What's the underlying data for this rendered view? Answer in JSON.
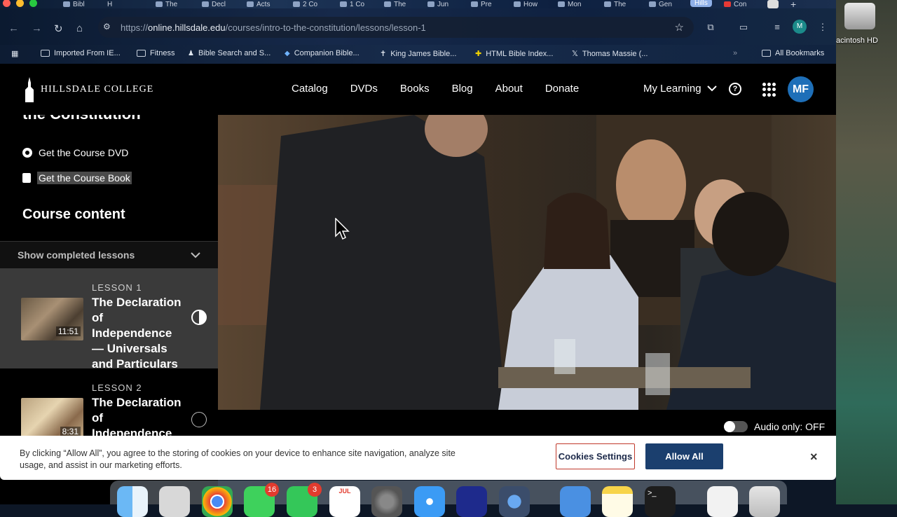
{
  "desktop": {
    "drive_label": "acintosh HD"
  },
  "browser": {
    "tabs": [
      "Bibl",
      "H",
      "The",
      "Decl",
      "Acts",
      "2 Co",
      "1 Co",
      "The",
      "Jun",
      "Pre",
      "How",
      "Mon",
      "The",
      "Gen",
      "Hills",
      "Con"
    ],
    "active_tab": "Hills",
    "url_host": "online.hillsdale.edu",
    "url_path": "/courses/intro-to-the-constitution/lessons/lesson-1",
    "url_scheme": "https://",
    "profile_initial": "M",
    "bookmarks": [
      "Imported From IE...",
      "Fitness",
      "Bible Search and S...",
      "Companion Bible...",
      "King James Bible...",
      "HTML Bible Index...",
      "Thomas Massie (...",
      "All Bookmarks"
    ]
  },
  "header": {
    "logo_text": "HILLSDALE COLLEGE",
    "nav": [
      "Catalog",
      "DVDs",
      "Books",
      "Blog",
      "About",
      "Donate"
    ],
    "my_learning": "My Learning",
    "avatar_initials": "MF"
  },
  "sidebar": {
    "course_title": "the Constitution",
    "links": [
      "Get the Course DVD",
      "Get the Course Book"
    ],
    "content_heading": "Course content",
    "show_completed": "Show completed lessons",
    "lessons": [
      {
        "number": "LESSON 1",
        "title": "The Declaration of Independence — Universals and Particulars",
        "duration": "11:51",
        "progress": 0.5
      },
      {
        "number": "LESSON 2",
        "title": "The Declaration of Independence — The Laws of Nature",
        "duration": "8:31",
        "progress": 0
      }
    ]
  },
  "player": {
    "audio_only_label": "Audio only: OFF"
  },
  "cookie_banner": {
    "text": "By clicking “Allow All”, you agree to the storing of cookies on your device to enhance site navigation, analyze site usage, and assist in our marketing efforts.",
    "settings_button": "Cookies Settings",
    "allow_button": "Allow All",
    "close": "×"
  },
  "dock": {
    "badges": {
      "messages": "16",
      "facetime": "3"
    },
    "calendar_month": "JUL"
  },
  "colors": {
    "accent": "#1e6fb8",
    "allow_btn": "#1b3f6e",
    "settings_border": "#c0392b"
  }
}
